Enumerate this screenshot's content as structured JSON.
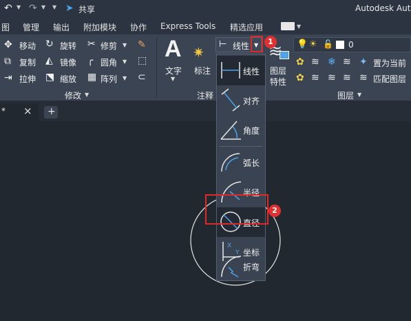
{
  "quick_access": {
    "share_label": "共享"
  },
  "title": {
    "app_title": "Autodesk Auto"
  },
  "menu": {
    "tabs": [
      "图",
      "管理",
      "输出",
      "附加模块",
      "协作",
      "Express Tools",
      "精选应用"
    ]
  },
  "modify_panel": {
    "title": "修改",
    "items": {
      "move": "移动",
      "rotate": "旋转",
      "trim": "修剪",
      "copy": "复制",
      "mirror": "镜像",
      "fillet": "圆角",
      "stretch": "拉伸",
      "scale": "缩放",
      "array": "阵列"
    }
  },
  "annotation_panel": {
    "title": "注释",
    "text_label": "文字",
    "dim_label": "标注",
    "linear_dropdown_label": "线性"
  },
  "layers_panel": {
    "title": "图层",
    "layer_props_label_1": "图层",
    "layer_props_label_2": "特性",
    "current_layer_value": "0",
    "set_current_label": "置为当前",
    "match_layer_label": "匹配图层"
  },
  "file_tabs": {
    "close_glyph": "×",
    "add_glyph": "+",
    "tab_marker": "*"
  },
  "dimension_menu": {
    "items": [
      "线性",
      "对齐",
      "角度",
      "弧长",
      "半径",
      "直径",
      "坐标",
      "折弯"
    ],
    "highlighted_index": 5
  },
  "callouts": {
    "first": "1",
    "second": "2"
  },
  "colors": {
    "accent_blue": "#4fa3e8",
    "callout_red": "#e03030",
    "ribbon_bg": "#3b4453",
    "canvas_bg": "#212830"
  }
}
